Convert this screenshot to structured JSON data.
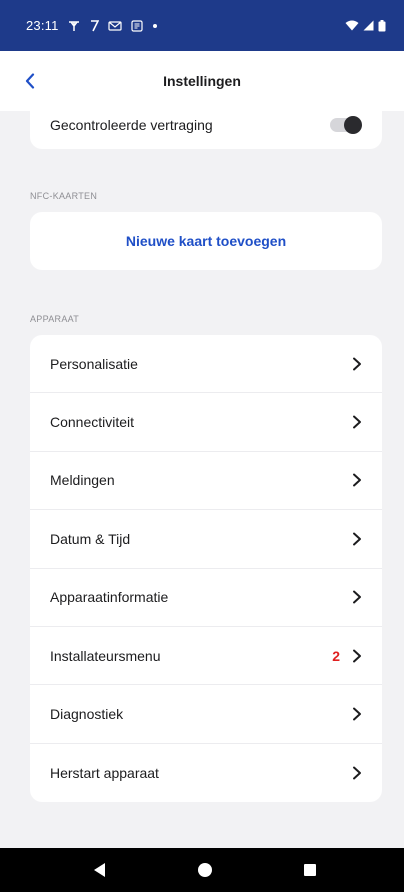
{
  "status_bar": {
    "time": "23:11",
    "left_icons": [
      "antenna-icon",
      "signal-t-icon",
      "voicemail-icon",
      "screenshot-icon",
      "dot-icon"
    ],
    "right_icons": [
      "wifi-icon",
      "cell-signal-icon",
      "battery-icon"
    ]
  },
  "header": {
    "title": "Instellingen",
    "back_icon": "chevron-left-icon"
  },
  "delay": {
    "label": "Gecontroleerde vertraging",
    "toggle_on": false
  },
  "nfc_section": {
    "header": "NFC-KAARTEN",
    "add_label": "Nieuwe kaart toevoegen"
  },
  "device_section": {
    "header": "APPARAAT",
    "items": [
      {
        "label": "Personalisatie",
        "badge": ""
      },
      {
        "label": "Connectiviteit",
        "badge": ""
      },
      {
        "label": "Meldingen",
        "badge": ""
      },
      {
        "label": "Datum & Tijd",
        "badge": ""
      },
      {
        "label": "Apparaatinformatie",
        "badge": ""
      },
      {
        "label": "Installateursmenu",
        "badge": "2"
      },
      {
        "label": "Diagnostiek",
        "badge": ""
      },
      {
        "label": "Herstart apparaat",
        "badge": ""
      }
    ]
  },
  "colors": {
    "status_bar": "#1e3a8a",
    "accent": "#1f4fc7",
    "badge": "#e02020",
    "background": "#f2f2f4"
  }
}
